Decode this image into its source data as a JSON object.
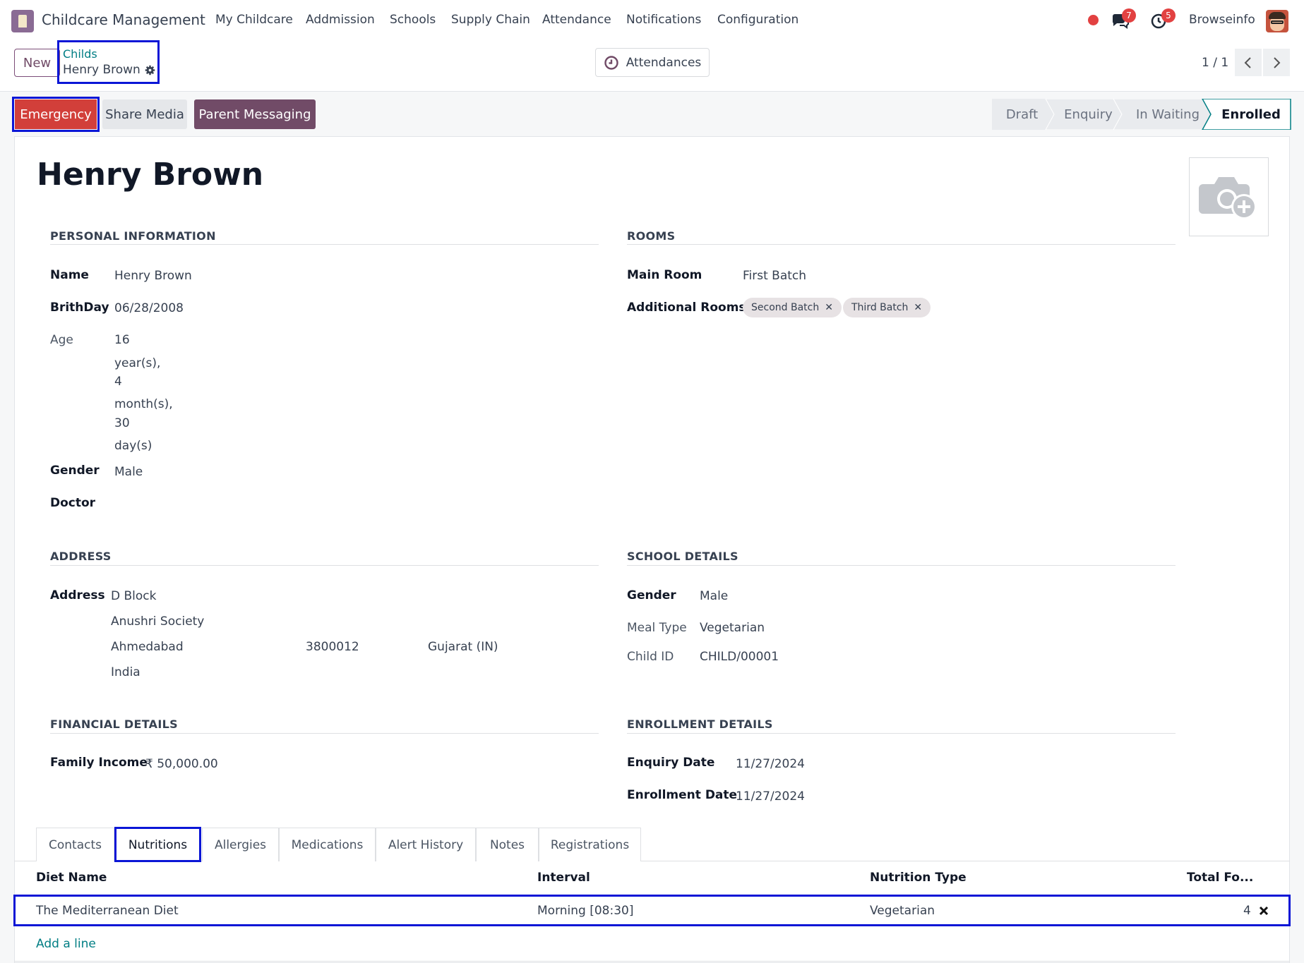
{
  "navbar": {
    "app_name": "Childcare Management",
    "menus": [
      "My Childcare",
      "Addmission",
      "Schools",
      "Supply Chain",
      "Attendance",
      "Notifications",
      "Configuration"
    ],
    "messages_count": "7",
    "activities_count": "5",
    "user": "Browseinfo"
  },
  "control": {
    "new_label": "New",
    "breadcrumb_parent": "Childs",
    "breadcrumb_current": "Henry Brown",
    "attendances_label": "Attendances",
    "pager": "1 / 1"
  },
  "actions": {
    "emergency": "Emergency",
    "share_media": "Share Media",
    "parent_messaging": "Parent Messaging"
  },
  "stages": [
    "Draft",
    "Enquiry",
    "In Waiting",
    "Enrolled"
  ],
  "active_stage": "Enrolled",
  "record": {
    "title": "Henry Brown",
    "personal": {
      "section": "PERSONAL INFORMATION",
      "name_label": "Name",
      "name": "Henry Brown",
      "birthday_label": "BrithDay",
      "birthday": "06/28/2008",
      "age_label": "Age",
      "age_lines": [
        "16",
        "year(s),",
        "4",
        "month(s),",
        "30",
        "day(s)"
      ],
      "gender_label": "Gender",
      "gender": "Male",
      "doctor_label": "Doctor"
    },
    "rooms": {
      "section": "ROOMS",
      "main_room_label": "Main Room",
      "main_room": "First Batch",
      "additional_label": "Additional Rooms",
      "additional": [
        "Second Batch",
        "Third Batch"
      ]
    },
    "address": {
      "section": "ADDRESS",
      "label": "Address",
      "street": "D Block",
      "street2": "Anushri Society",
      "city": "Ahmedabad",
      "zip": "3800012",
      "state": "Gujarat (IN)",
      "country": "India"
    },
    "school": {
      "section": "SCHOOL DETAILS",
      "gender_label": "Gender",
      "gender": "Male",
      "meal_label": "Meal Type",
      "meal": "Vegetarian",
      "child_id_label": "Child ID",
      "child_id": "CHILD/00001"
    },
    "financial": {
      "section": "FINANCIAL DETAILS",
      "income_label": "Family Income",
      "income": "₹ 50,000.00"
    },
    "enrollment": {
      "section": "ENROLLMENT DETAILS",
      "enquiry_label": "Enquiry Date",
      "enquiry": "11/27/2024",
      "enrollment_label": "Enrollment Date",
      "enrollment": "11/27/2024"
    }
  },
  "tabs": [
    "Contacts",
    "Nutritions",
    "Allergies",
    "Medications",
    "Alert History",
    "Notes",
    "Registrations"
  ],
  "active_tab": "Nutritions",
  "nutrition_table": {
    "headers": [
      "Diet Name",
      "Interval",
      "Nutrition Type",
      "Total Fo..."
    ],
    "rows": [
      {
        "diet": "The Mediterranean Diet",
        "interval": "Morning [08:30]",
        "type": "Vegetarian",
        "total": "4"
      }
    ],
    "add_line": "Add a line"
  }
}
